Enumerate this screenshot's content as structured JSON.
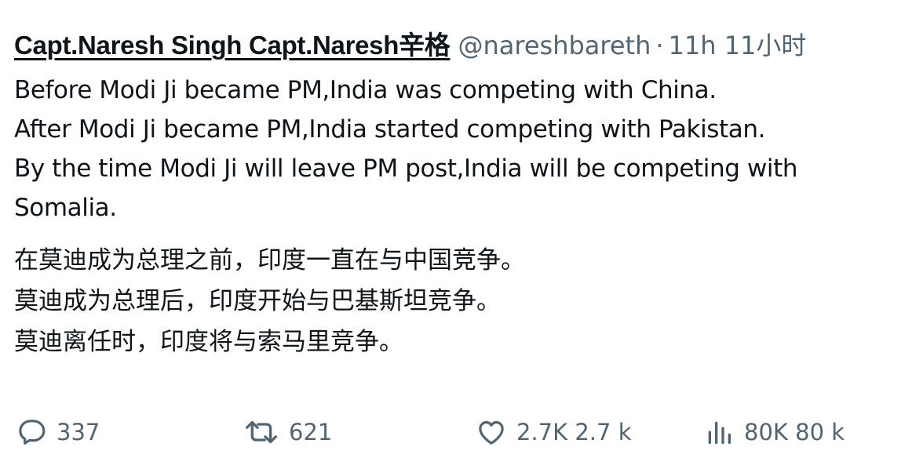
{
  "tweet": {
    "display_name": "Capt.Naresh Singh Capt.Naresh辛格",
    "handle": "@nareshbareth",
    "separator": "·",
    "time": "11h 11小时",
    "body_en": [
      "Before Modi Ji became PM,India was competing with China.",
      "After Modi Ji became PM,India started competing with Pakistan.",
      "By the time Modi Ji will leave PM post,India will be competing with",
      "Somalia."
    ],
    "body_zh": [
      "在莫迪成为总理之前，印度一直在与中国竞争。",
      "莫迪成为总理后，印度开始与巴基斯坦竞争。",
      "莫迪离任时，印度将与索马里竞争。"
    ]
  },
  "actions": {
    "reply": {
      "icon": "reply-icon",
      "count": "337"
    },
    "retweet": {
      "icon": "retweet-icon",
      "count": "621"
    },
    "like": {
      "icon": "heart-icon",
      "count": "2.7K 2.7 k"
    },
    "views": {
      "icon": "views-icon",
      "count": "80K 80 k"
    }
  },
  "colors": {
    "text": "#0f1419",
    "muted": "#536471",
    "background": "#ffffff"
  }
}
